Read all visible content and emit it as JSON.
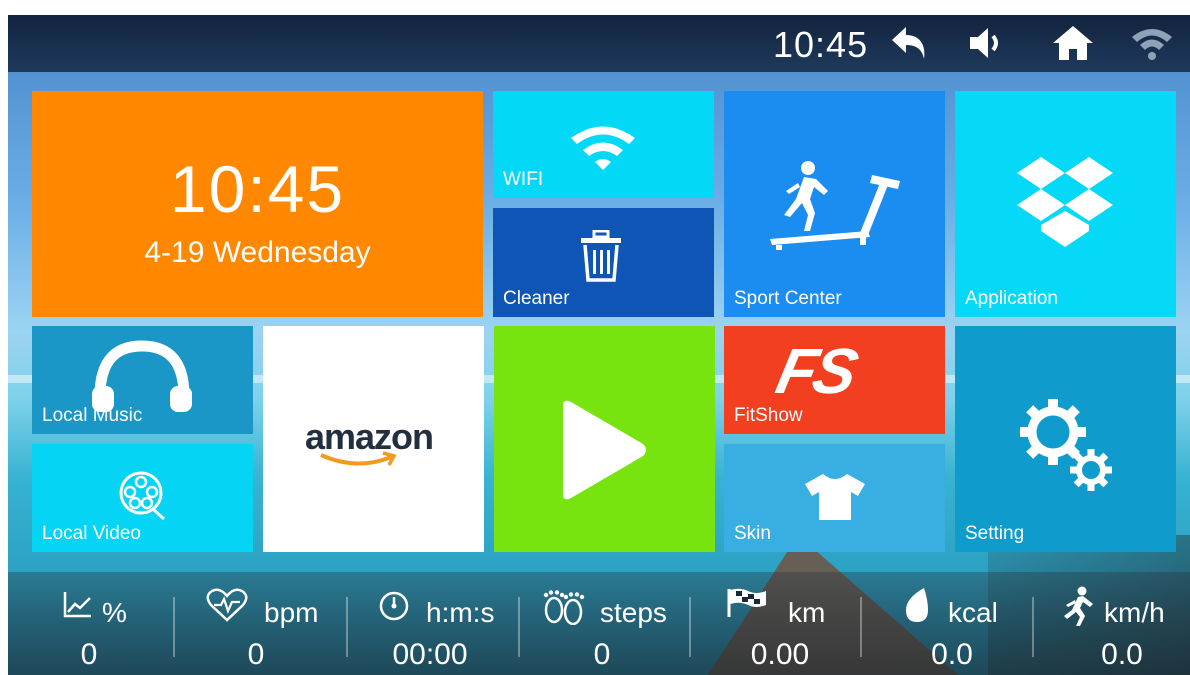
{
  "status_bar": {
    "time": "10:45",
    "icons": [
      "back-icon",
      "volume-icon",
      "home-icon",
      "wifi-icon"
    ]
  },
  "clock_tile": {
    "time": "10:45",
    "date": "4-19 Wednesday"
  },
  "tiles": {
    "wifi": "WIFI",
    "cleaner": "Cleaner",
    "sport_center": "Sport Center",
    "application": "Application",
    "local_music": "Local Music",
    "amazon": "amazon",
    "fitshow": "FitShow",
    "fitshow_logo": "FS",
    "setting": "Setting",
    "local_video": "Local Video",
    "skin": "Skin"
  },
  "colors": {
    "clock_tile": "#ff8800",
    "wifi_tile": "#03d8f7",
    "cleaner_tile": "#0e55b5",
    "sport_tile": "#1b8cf0",
    "application_tile": "#06d8f7",
    "music_tile": "#1a96c7",
    "amazon_tile": "#ffffff",
    "play_tile": "#77e410",
    "fitshow_tile": "#f23f1f",
    "setting_tile": "#0f9bcc",
    "video_tile": "#05d4f5",
    "skin_tile": "#38aee2"
  },
  "stats": [
    {
      "icon": "chart-icon",
      "unit": "%",
      "value": "0"
    },
    {
      "icon": "heart-rate-icon",
      "unit": "bpm",
      "value": "0"
    },
    {
      "icon": "timer-icon",
      "unit": "h:m:s",
      "value": "00:00"
    },
    {
      "icon": "footprints-icon",
      "unit": "steps",
      "value": "0"
    },
    {
      "icon": "finish-flag-icon",
      "unit": "km",
      "value": "0.00"
    },
    {
      "icon": "drop-icon",
      "unit": "kcal",
      "value": "0.0"
    },
    {
      "icon": "runner-icon",
      "unit": "km/h",
      "value": "0.0"
    }
  ]
}
